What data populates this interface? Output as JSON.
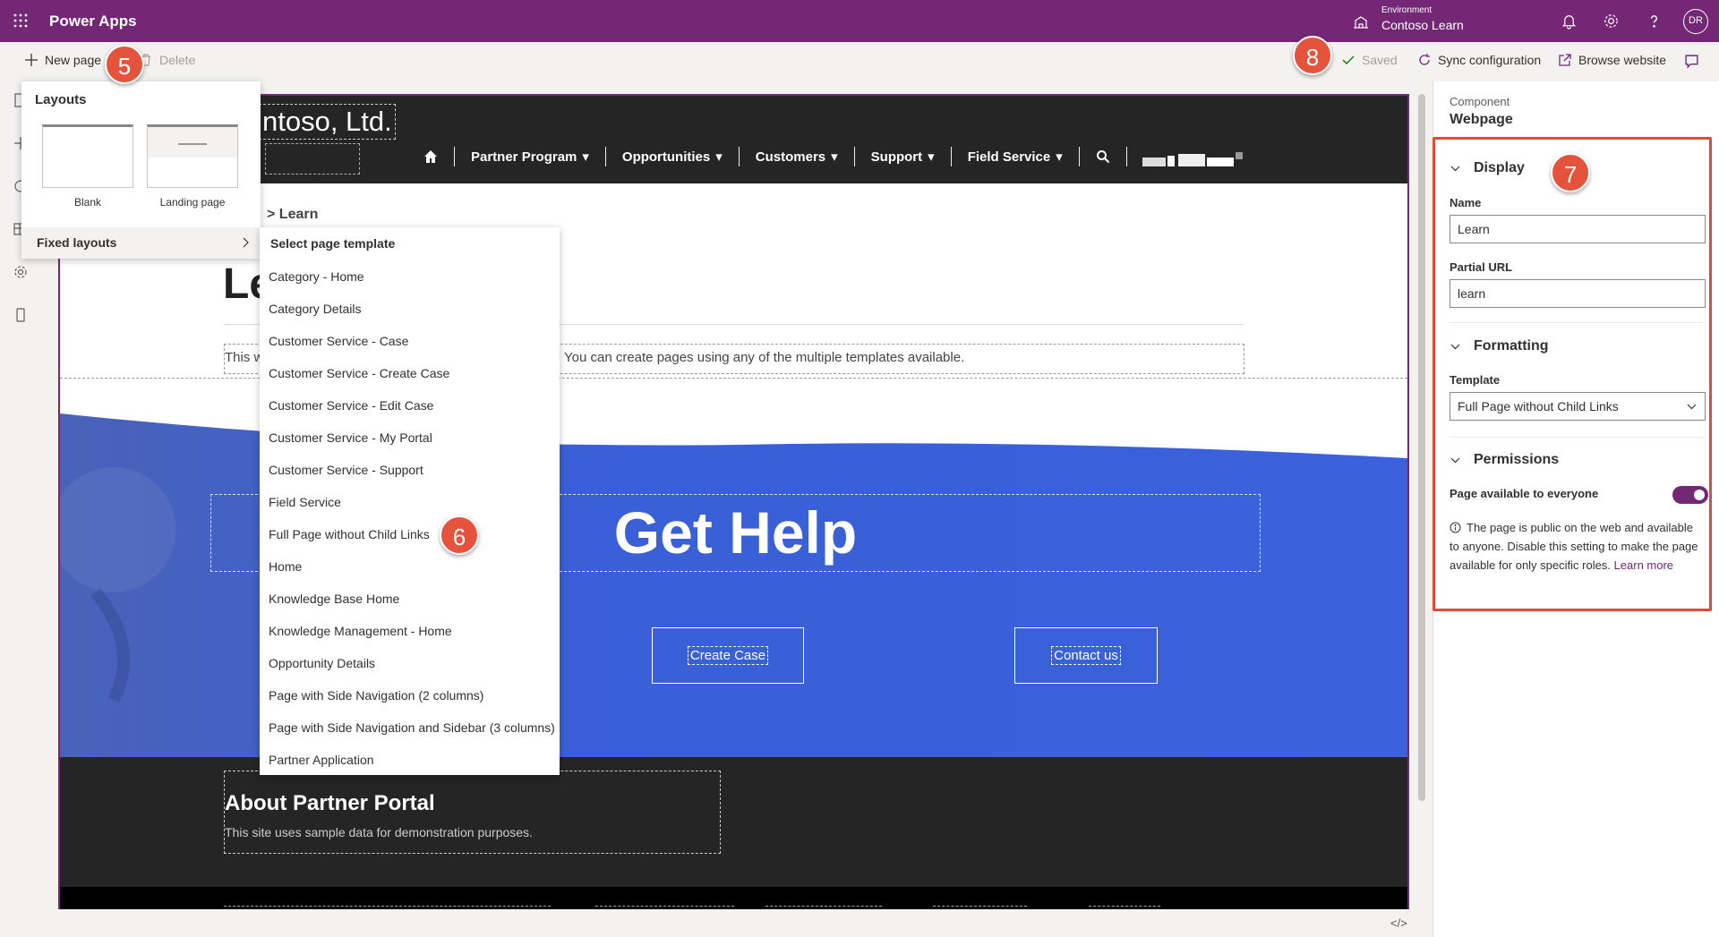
{
  "topbar": {
    "app_name": "Power Apps",
    "environment_label": "Environment",
    "environment_name": "Contoso Learn",
    "avatar": "DR",
    "icons": [
      "waffle-icon",
      "environment-icon",
      "bell-icon",
      "gear-icon",
      "help-icon"
    ]
  },
  "commands": {
    "new_page": "New page",
    "delete": "Delete",
    "saved": "Saved",
    "sync": "Sync configuration",
    "browse": "Browse website"
  },
  "layouts_menu": {
    "title": "Layouts",
    "items": [
      "Blank",
      "Landing page"
    ],
    "fixed_layouts": "Fixed layouts"
  },
  "templates_menu": {
    "title": "Select page template",
    "items": [
      "Category - Home",
      "Category Details",
      "Customer Service - Case",
      "Customer Service - Create Case",
      "Customer Service - Edit Case",
      "Customer Service - My Portal",
      "Customer Service - Support",
      "Field Service",
      "Full Page without Child Links",
      "Home",
      "Knowledge Base Home",
      "Knowledge Management - Home",
      "Opportunity Details",
      "Page with Side Navigation (2 columns)",
      "Page with Side Navigation and Sidebar (3 columns)",
      "Partner Application"
    ]
  },
  "site": {
    "brand": "ntoso, Ltd.",
    "nav": [
      "Partner Program",
      "Opportunities",
      "Customers",
      "Support",
      "Field Service"
    ],
    "breadcrumb": "> Learn",
    "page_heading": "Le",
    "description_start": "This w",
    "description_end": "You can create pages using any of the multiple templates available.",
    "hero_title": "Get Help",
    "hero_buttons": [
      "Create Case",
      "Contact us"
    ],
    "about_heading": "About Partner Portal",
    "about_text": "This site uses sample data for demonstration purposes."
  },
  "panel": {
    "component_label": "Component",
    "component_value": "Webpage",
    "display_header": "Display",
    "name_label": "Name",
    "name_value": "Learn",
    "url_label": "Partial URL",
    "url_value": "learn",
    "formatting_header": "Formatting",
    "template_label": "Template",
    "template_value": "Full Page without Child Links",
    "permissions_header": "Permissions",
    "everyone_label": "Page available to everyone",
    "everyone_on": true,
    "info_text": "The page is public on the web and available to anyone. Disable this setting to make the page available for only specific roles.",
    "learn_more": "Learn more"
  },
  "callouts": [
    "5",
    "6",
    "7",
    "8"
  ],
  "colors": {
    "brand": "#742774",
    "hero": "#3a5fd6",
    "callout": "#e5533d",
    "highlight_box": "#e04b40"
  }
}
